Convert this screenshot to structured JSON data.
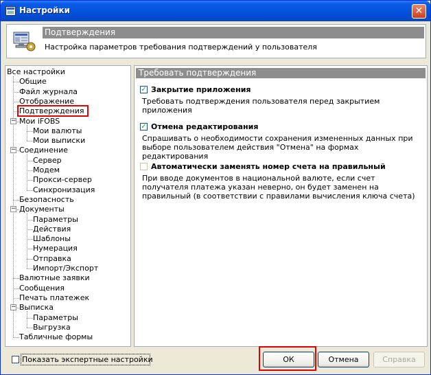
{
  "window": {
    "title": "Настройки"
  },
  "header": {
    "section_title": "Подтверждения",
    "description": "Настройка параметров требования подтверждений у пользователя"
  },
  "tree": {
    "root": "Все настройки",
    "items": [
      {
        "label": "Общие",
        "level": 1
      },
      {
        "label": "Файл журнала",
        "level": 1
      },
      {
        "label": "Отображение",
        "level": 1
      },
      {
        "label": "Подтверждения",
        "level": 1,
        "selected": true
      },
      {
        "label": "Мои iFOBS",
        "level": 1,
        "expander": "minus"
      },
      {
        "label": "Мои валюты",
        "level": 2
      },
      {
        "label": "Мои выписки",
        "level": 2
      },
      {
        "label": "Соединение",
        "level": 1,
        "expander": "minus"
      },
      {
        "label": "Сервер",
        "level": 2
      },
      {
        "label": "Модем",
        "level": 2
      },
      {
        "label": "Прокси-сервер",
        "level": 2
      },
      {
        "label": "Синхронизация",
        "level": 2
      },
      {
        "label": "Безопасность",
        "level": 1
      },
      {
        "label": "Документы",
        "level": 1,
        "expander": "minus"
      },
      {
        "label": "Параметры",
        "level": 2
      },
      {
        "label": "Действия",
        "level": 2
      },
      {
        "label": "Шаблоны",
        "level": 2
      },
      {
        "label": "Нумерация",
        "level": 2
      },
      {
        "label": "Отправка",
        "level": 2
      },
      {
        "label": "Импорт/Экспорт",
        "level": 2
      },
      {
        "label": "Валютные заявки",
        "level": 1
      },
      {
        "label": "Сообщения",
        "level": 1
      },
      {
        "label": "Печать платежек",
        "level": 1
      },
      {
        "label": "Выписка",
        "level": 1,
        "expander": "minus"
      },
      {
        "label": "Параметры",
        "level": 2
      },
      {
        "label": "Выгрузка",
        "level": 2
      },
      {
        "label": "Табличные формы",
        "level": 1
      }
    ]
  },
  "panel": {
    "section_title": "Требовать подтверждения",
    "options": [
      {
        "label": "Закрытие приложения",
        "checked": true,
        "enabled": true,
        "desc": "Требовать подтверждения пользователя перед закрытием приложения"
      },
      {
        "label": "Отмена редактирования",
        "checked": true,
        "enabled": true,
        "desc": "Спрашивать о необходимости сохранения измененных данных при выборе пользователем действия \"Отмена\" на формах редактирования"
      },
      {
        "label": "Автоматически заменять номер счета на правильный",
        "checked": false,
        "enabled": false,
        "desc": "При вводе документов в национальной валюте, если счет получателя платежа указан неверно, он будет заменен на правильный (в соответствии с правилами вычисления ключа счета)"
      }
    ]
  },
  "footer": {
    "expert_label": "Показать экспертные настройки",
    "expert_checked": false,
    "ok_label": "ОК",
    "cancel_label": "Отмена",
    "help_label": "Справка"
  },
  "colors": {
    "titlebar": "#0453DC",
    "band": "#8D8D8D",
    "highlight": "#E00000",
    "check": "#21A121"
  }
}
